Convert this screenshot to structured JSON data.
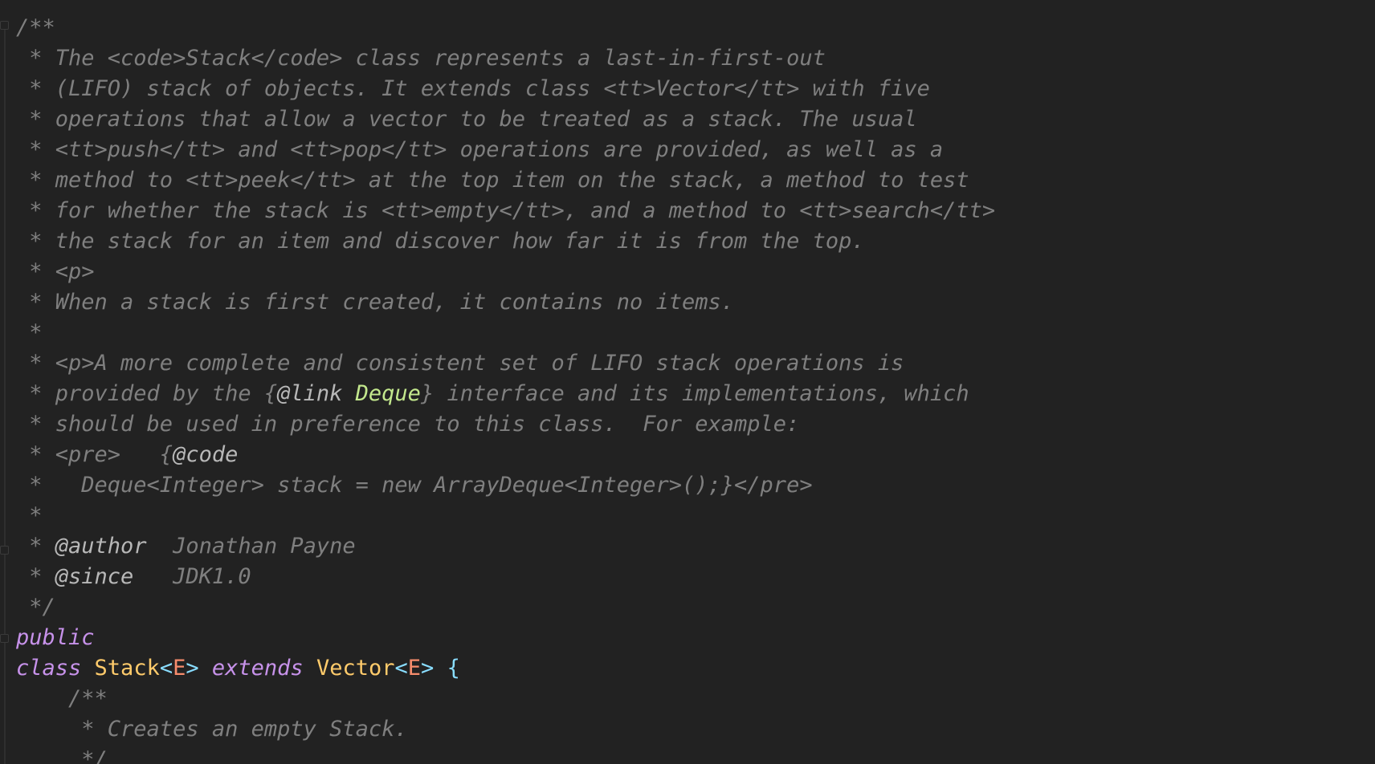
{
  "lines": [
    [
      {
        "t": "/**",
        "c": "cm"
      }
    ],
    [
      {
        "t": " * The <code>Stack</code> class represents a last-in-first-out",
        "c": "cm"
      }
    ],
    [
      {
        "t": " * (LIFO) stack of objects. It extends class <tt>Vector</tt> with five",
        "c": "cm"
      }
    ],
    [
      {
        "t": " * operations that allow a vector to be treated as a stack. The usual",
        "c": "cm"
      }
    ],
    [
      {
        "t": " * <tt>push</tt> and <tt>pop</tt> operations are provided, as well as a",
        "c": "cm"
      }
    ],
    [
      {
        "t": " * method to <tt>peek</tt> at the top item on the stack, a method to test",
        "c": "cm"
      }
    ],
    [
      {
        "t": " * for whether the stack is <tt>empty</tt>, and a method to <tt>search</tt>",
        "c": "cm"
      }
    ],
    [
      {
        "t": " * the stack for an item and discover how far it is from the top.",
        "c": "cm"
      }
    ],
    [
      {
        "t": " * <p>",
        "c": "cm"
      }
    ],
    [
      {
        "t": " * When a stack is first created, it contains no items.",
        "c": "cm"
      }
    ],
    [
      {
        "t": " *",
        "c": "cm"
      }
    ],
    [
      {
        "t": " * <p>A more complete and consistent set of LIFO stack operations is",
        "c": "cm"
      }
    ],
    [
      {
        "t": " * provided by the {",
        "c": "cm"
      },
      {
        "t": "@link",
        "c": "tag"
      },
      {
        "t": " ",
        "c": "cm"
      },
      {
        "t": "Deque",
        "c": "ref"
      },
      {
        "t": "} interface and its implementations, which",
        "c": "cm"
      }
    ],
    [
      {
        "t": " * should be used in preference to this class.  For example:",
        "c": "cm"
      }
    ],
    [
      {
        "t": " * <pre>   {",
        "c": "cm"
      },
      {
        "t": "@code",
        "c": "tag"
      }
    ],
    [
      {
        "t": " *   Deque<Integer> stack = new ArrayDeque<Integer>();}</pre>",
        "c": "cm"
      }
    ],
    [
      {
        "t": " *",
        "c": "cm"
      }
    ],
    [
      {
        "t": " * ",
        "c": "cm"
      },
      {
        "t": "@author",
        "c": "tag"
      },
      {
        "t": "  Jonathan Payne",
        "c": "cm"
      }
    ],
    [
      {
        "t": " * ",
        "c": "cm"
      },
      {
        "t": "@since",
        "c": "tag"
      },
      {
        "t": "   JDK1.0",
        "c": "cm"
      }
    ],
    [
      {
        "t": " */",
        "c": "cm"
      }
    ],
    [
      {
        "t": "public",
        "c": "kw"
      }
    ],
    [
      {
        "t": "class",
        "c": "kw"
      },
      {
        "t": " ",
        "c": "pl"
      },
      {
        "t": "Stack",
        "c": "cls"
      },
      {
        "t": "<",
        "c": "br"
      },
      {
        "t": "E",
        "c": "tp"
      },
      {
        "t": ">",
        "c": "br"
      },
      {
        "t": " ",
        "c": "pl"
      },
      {
        "t": "extends",
        "c": "kw"
      },
      {
        "t": " ",
        "c": "pl"
      },
      {
        "t": "Vector",
        "c": "cls"
      },
      {
        "t": "<",
        "c": "br"
      },
      {
        "t": "E",
        "c": "tp"
      },
      {
        "t": ">",
        "c": "br"
      },
      {
        "t": " ",
        "c": "pl"
      },
      {
        "t": "{",
        "c": "br"
      }
    ],
    [
      {
        "t": "    /**",
        "c": "cm"
      }
    ],
    [
      {
        "t": "     * Creates an empty Stack.",
        "c": "cm"
      }
    ],
    [
      {
        "t": "     */",
        "c": "cm"
      }
    ]
  ]
}
